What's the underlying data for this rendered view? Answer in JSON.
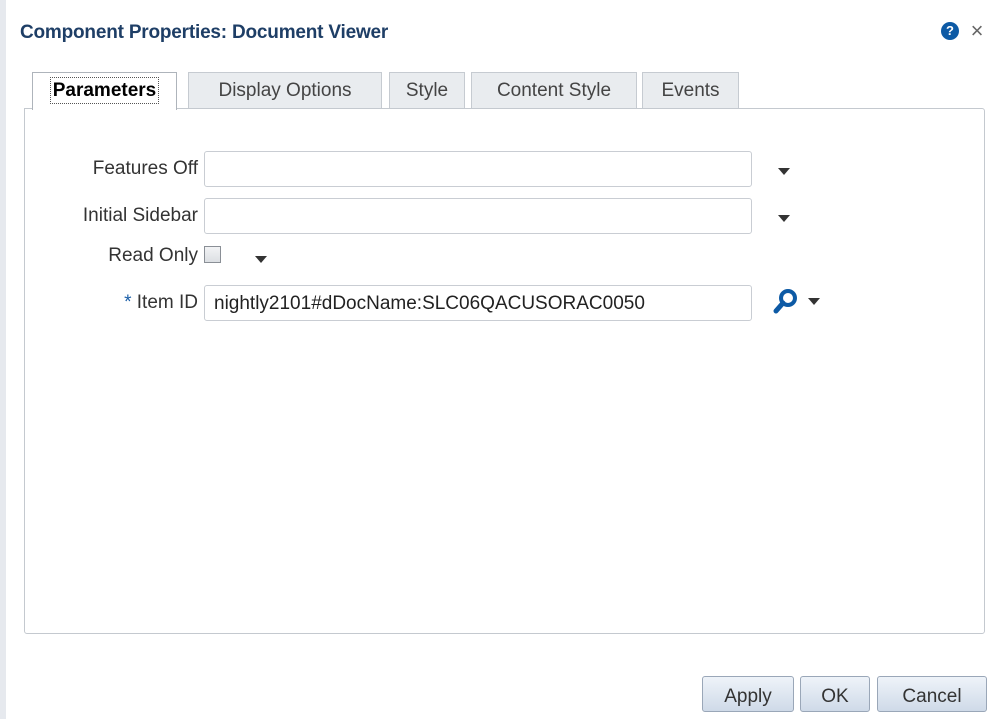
{
  "dialog": {
    "title": "Component Properties: Document Viewer",
    "help_icon_glyph": "?",
    "close_icon_glyph": "×"
  },
  "tabs": [
    {
      "label": "Parameters",
      "active": true
    },
    {
      "label": "Display Options",
      "active": false
    },
    {
      "label": "Style",
      "active": false
    },
    {
      "label": "Content Style",
      "active": false
    },
    {
      "label": "Events",
      "active": false
    }
  ],
  "fields": {
    "features_off": {
      "label": "Features Off",
      "value": ""
    },
    "initial_sidebar": {
      "label": "Initial Sidebar",
      "value": ""
    },
    "read_only": {
      "label": "Read Only",
      "checked": false
    },
    "item_id": {
      "label": "Item ID",
      "required_marker": "*",
      "value": "nightly2101#dDocName:SLC06QACUSORAC0050"
    }
  },
  "buttons": {
    "apply": "Apply",
    "ok": "OK",
    "cancel": "Cancel"
  },
  "colors": {
    "title": "#1e3e66",
    "accent": "#0d5aa5"
  }
}
